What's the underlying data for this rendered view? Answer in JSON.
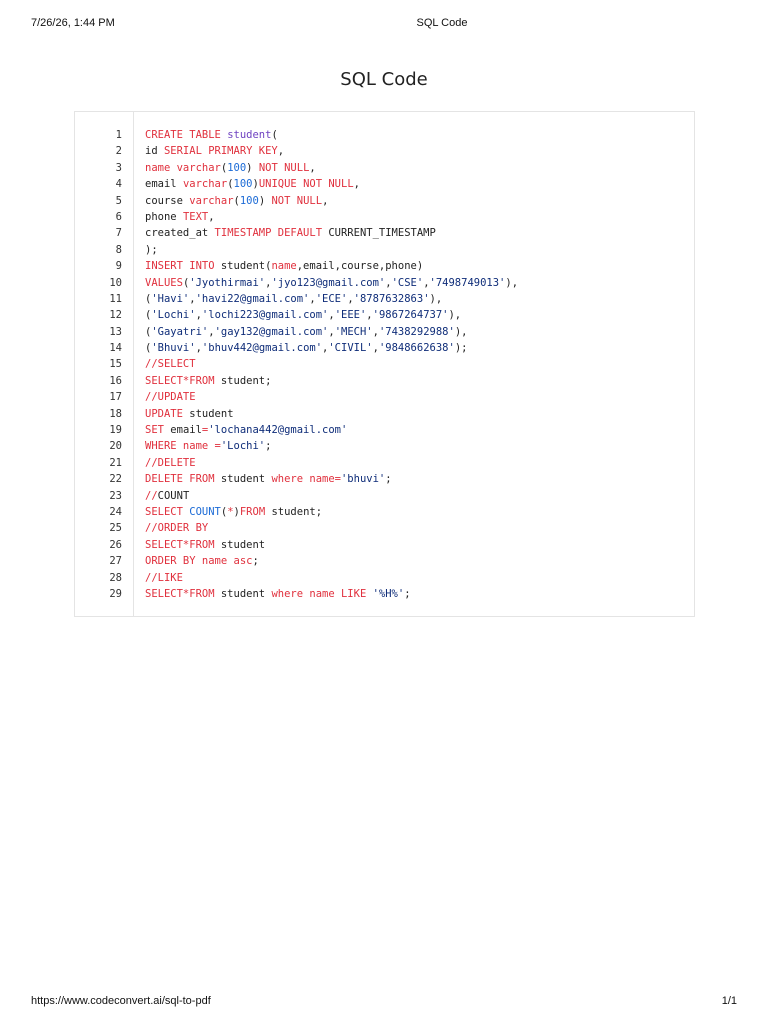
{
  "header": {
    "date": "7/26/26, 1:44 PM",
    "title": "SQL Code"
  },
  "document": {
    "title": "SQL Code"
  },
  "footer": {
    "url": "https://www.codeconvert.ai/sql-to-pdf",
    "page": "1/1"
  },
  "colors": {
    "keyword": "#e0303d",
    "type": "#6f42c1",
    "number": "#1c6bd6",
    "string": "#0f2d79",
    "plain": "#222222"
  },
  "code": {
    "lines": [
      [
        [
          "k",
          "CREATE TABLE "
        ],
        [
          "t",
          "student"
        ],
        [
          "p",
          "("
        ]
      ],
      [
        [
          "p",
          "id "
        ],
        [
          "k",
          "SERIAL PRIMARY KEY"
        ],
        [
          "p",
          ","
        ]
      ],
      [
        [
          "k",
          "name varchar"
        ],
        [
          "p",
          "("
        ],
        [
          "n",
          "100"
        ],
        [
          "p",
          ") "
        ],
        [
          "k",
          "NOT NULL"
        ],
        [
          "p",
          ","
        ]
      ],
      [
        [
          "p",
          "email "
        ],
        [
          "k",
          "varchar"
        ],
        [
          "p",
          "("
        ],
        [
          "n",
          "100"
        ],
        [
          "p",
          ")"
        ],
        [
          "k",
          "UNIQUE NOT NULL"
        ],
        [
          "p",
          ","
        ]
      ],
      [
        [
          "p",
          "course "
        ],
        [
          "k",
          "varchar"
        ],
        [
          "p",
          "("
        ],
        [
          "n",
          "100"
        ],
        [
          "p",
          ") "
        ],
        [
          "k",
          "NOT NULL"
        ],
        [
          "p",
          ","
        ]
      ],
      [
        [
          "p",
          "phone "
        ],
        [
          "k",
          "TEXT"
        ],
        [
          "p",
          ","
        ]
      ],
      [
        [
          "p",
          "created_at "
        ],
        [
          "k",
          "TIMESTAMP DEFAULT "
        ],
        [
          "p",
          "CURRENT_TIMESTAMP"
        ]
      ],
      [
        [
          "p",
          ");"
        ]
      ],
      [
        [
          "k",
          "INSERT INTO "
        ],
        [
          "p",
          "student("
        ],
        [
          "k",
          "name"
        ],
        [
          "p",
          ",email,course,phone)"
        ]
      ],
      [
        [
          "k",
          "VALUES"
        ],
        [
          "p",
          "("
        ],
        [
          "s",
          "'Jyothirmai'"
        ],
        [
          "p",
          ","
        ],
        [
          "s",
          "'jyo123@gmail.com'"
        ],
        [
          "p",
          ","
        ],
        [
          "s",
          "'CSE'"
        ],
        [
          "p",
          ","
        ],
        [
          "s",
          "'7498749013'"
        ],
        [
          "p",
          "),"
        ]
      ],
      [
        [
          "p",
          "("
        ],
        [
          "s",
          "'Havi'"
        ],
        [
          "p",
          ","
        ],
        [
          "s",
          "'havi22@gmail.com'"
        ],
        [
          "p",
          ","
        ],
        [
          "s",
          "'ECE'"
        ],
        [
          "p",
          ","
        ],
        [
          "s",
          "'8787632863'"
        ],
        [
          "p",
          "),"
        ]
      ],
      [
        [
          "p",
          "("
        ],
        [
          "s",
          "'Lochi'"
        ],
        [
          "p",
          ","
        ],
        [
          "s",
          "'lochi223@gmail.com'"
        ],
        [
          "p",
          ","
        ],
        [
          "s",
          "'EEE'"
        ],
        [
          "p",
          ","
        ],
        [
          "s",
          "'9867264737'"
        ],
        [
          "p",
          "),"
        ]
      ],
      [
        [
          "p",
          "("
        ],
        [
          "s",
          "'Gayatri'"
        ],
        [
          "p",
          ","
        ],
        [
          "s",
          "'gay132@gmail.com'"
        ],
        [
          "p",
          ","
        ],
        [
          "s",
          "'MECH'"
        ],
        [
          "p",
          ","
        ],
        [
          "s",
          "'7438292988'"
        ],
        [
          "p",
          "),"
        ]
      ],
      [
        [
          "p",
          "("
        ],
        [
          "s",
          "'Bhuvi'"
        ],
        [
          "p",
          ","
        ],
        [
          "s",
          "'bhuv442@gmail.com'"
        ],
        [
          "p",
          ","
        ],
        [
          "s",
          "'CIVIL'"
        ],
        [
          "p",
          ","
        ],
        [
          "s",
          "'9848662638'"
        ],
        [
          "p",
          ");"
        ]
      ],
      [
        [
          "k",
          "//SELECT"
        ]
      ],
      [
        [
          "k",
          "SELECT*FROM "
        ],
        [
          "p",
          "student;"
        ]
      ],
      [
        [
          "k",
          "//UPDATE"
        ]
      ],
      [
        [
          "k",
          "UPDATE "
        ],
        [
          "p",
          "student"
        ]
      ],
      [
        [
          "k",
          "SET "
        ],
        [
          "p",
          "email"
        ],
        [
          "k",
          "="
        ],
        [
          "s",
          "'lochana442@gmail.com'"
        ]
      ],
      [
        [
          "k",
          "WHERE name ="
        ],
        [
          "s",
          "'Lochi'"
        ],
        [
          "p",
          ";"
        ]
      ],
      [
        [
          "k",
          "//DELETE"
        ]
      ],
      [
        [
          "k",
          "DELETE FROM "
        ],
        [
          "p",
          "student "
        ],
        [
          "k",
          "where name="
        ],
        [
          "s",
          "'bhuvi'"
        ],
        [
          "p",
          ";"
        ]
      ],
      [
        [
          "k",
          "//"
        ],
        [
          "p",
          "COUNT"
        ]
      ],
      [
        [
          "k",
          "SELECT "
        ],
        [
          "n",
          "COUNT"
        ],
        [
          "p",
          "("
        ],
        [
          "k",
          "*"
        ],
        [
          "p",
          ")"
        ],
        [
          "k",
          "FROM "
        ],
        [
          "p",
          "student;"
        ]
      ],
      [
        [
          "k",
          "//ORDER BY"
        ]
      ],
      [
        [
          "k",
          "SELECT*FROM "
        ],
        [
          "p",
          "student"
        ]
      ],
      [
        [
          "k",
          "ORDER BY name asc"
        ],
        [
          "p",
          ";"
        ]
      ],
      [
        [
          "k",
          "//LIKE"
        ]
      ],
      [
        [
          "k",
          "SELECT*FROM "
        ],
        [
          "p",
          "student "
        ],
        [
          "k",
          "where name LIKE "
        ],
        [
          "s",
          "'%H%'"
        ],
        [
          "p",
          ";"
        ]
      ]
    ]
  }
}
